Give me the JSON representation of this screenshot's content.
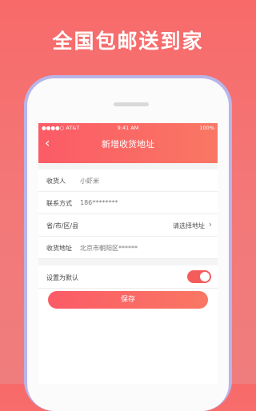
{
  "headline": "全国包邮送到家",
  "status": {
    "carrier": "●●●●○ AT&T",
    "time": "9:41 AM",
    "battery": "100%"
  },
  "nav": {
    "back_icon": "chevron-left-icon",
    "title": "新增收货地址"
  },
  "form": {
    "recipient": {
      "label": "收货人",
      "value": "小虾米"
    },
    "phone": {
      "label": "联系方式",
      "value": "186********"
    },
    "region": {
      "label": "省/市/区/县",
      "placeholder": "请选择地址"
    },
    "address": {
      "label": "收货地址",
      "value": "北京市朝阳区******"
    }
  },
  "default": {
    "label": "设置为默认",
    "on": true
  },
  "save_label": "保存",
  "colors": {
    "accent": "#f9626a",
    "toggle": "#f45c5c",
    "frame": "#b9b4e8"
  }
}
